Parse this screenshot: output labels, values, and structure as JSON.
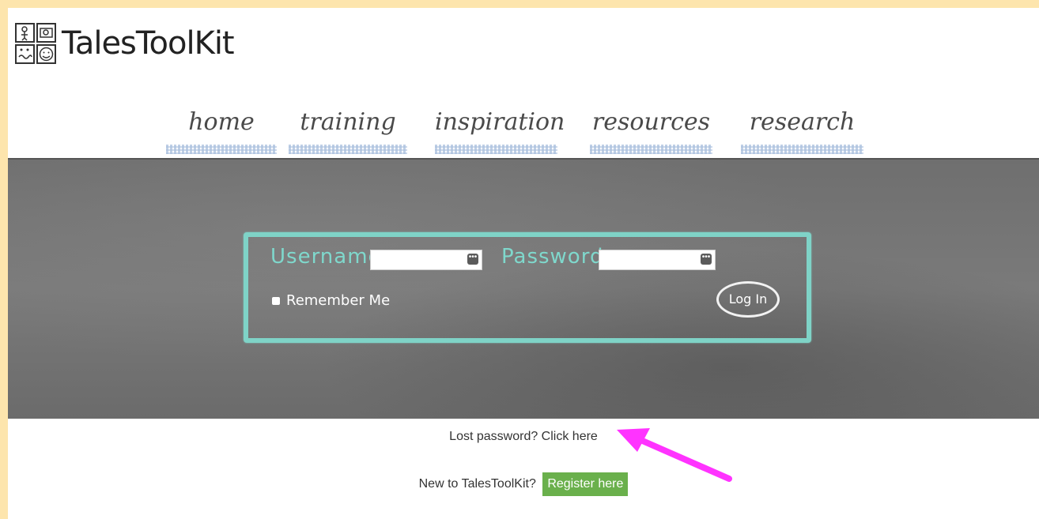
{
  "header": {
    "logo_text": "TalesToolKit"
  },
  "nav": {
    "items": [
      {
        "label": "home"
      },
      {
        "label": "training"
      },
      {
        "label": "inspiration"
      },
      {
        "label": "resources"
      },
      {
        "label": "research"
      }
    ]
  },
  "login": {
    "username_label": "Username",
    "password_label": "Password",
    "username_value": "",
    "password_value": "",
    "remember_label": "Remember Me",
    "login_button": "Log In",
    "frame_color": "#7fd3c7"
  },
  "footer": {
    "lost_password": "Lost password? Click here",
    "new_to": "New to TalesToolKit?",
    "register_button": "Register here",
    "register_color": "#6ab04c",
    "annotation_arrow_color": "#ff33ff"
  }
}
